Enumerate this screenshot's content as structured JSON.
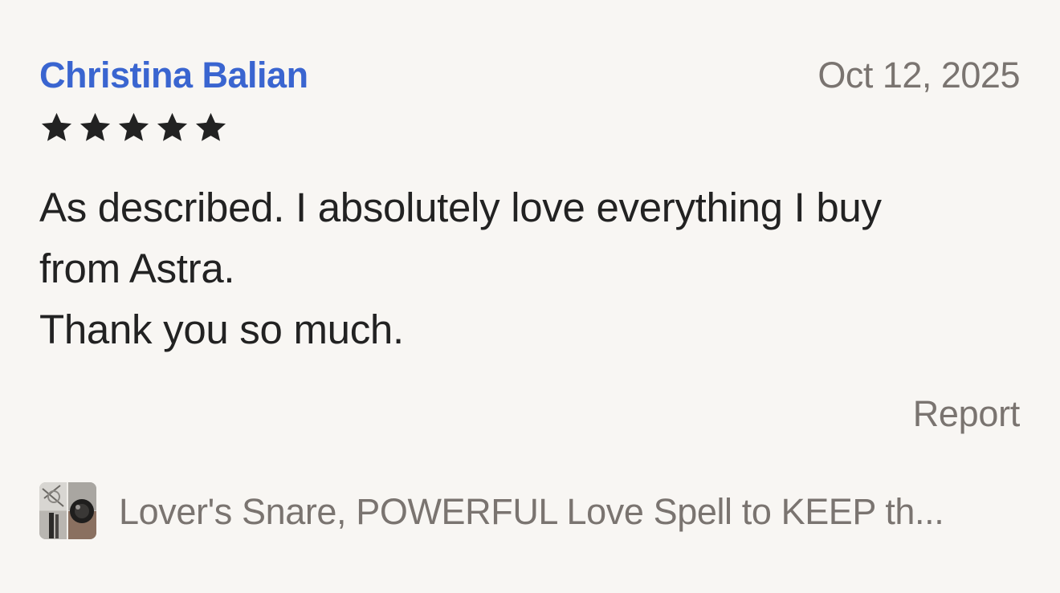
{
  "review": {
    "reviewer_name": "Christina Balian",
    "date": "Oct 12, 2025",
    "rating": 5,
    "rating_max": 5,
    "body_lines": [
      "As described. I absolutely love everything I buy",
      "from Astra.",
      "Thank you so much."
    ],
    "report_label": "Report"
  },
  "product": {
    "title": "Lover's Snare, POWERFUL Love Spell to KEEP th..."
  },
  "colors": {
    "reviewer_name": "#3a65d0",
    "muted_text": "#7a7470",
    "body_text": "#222222",
    "star": "#222222",
    "background": "#f8f6f3"
  }
}
